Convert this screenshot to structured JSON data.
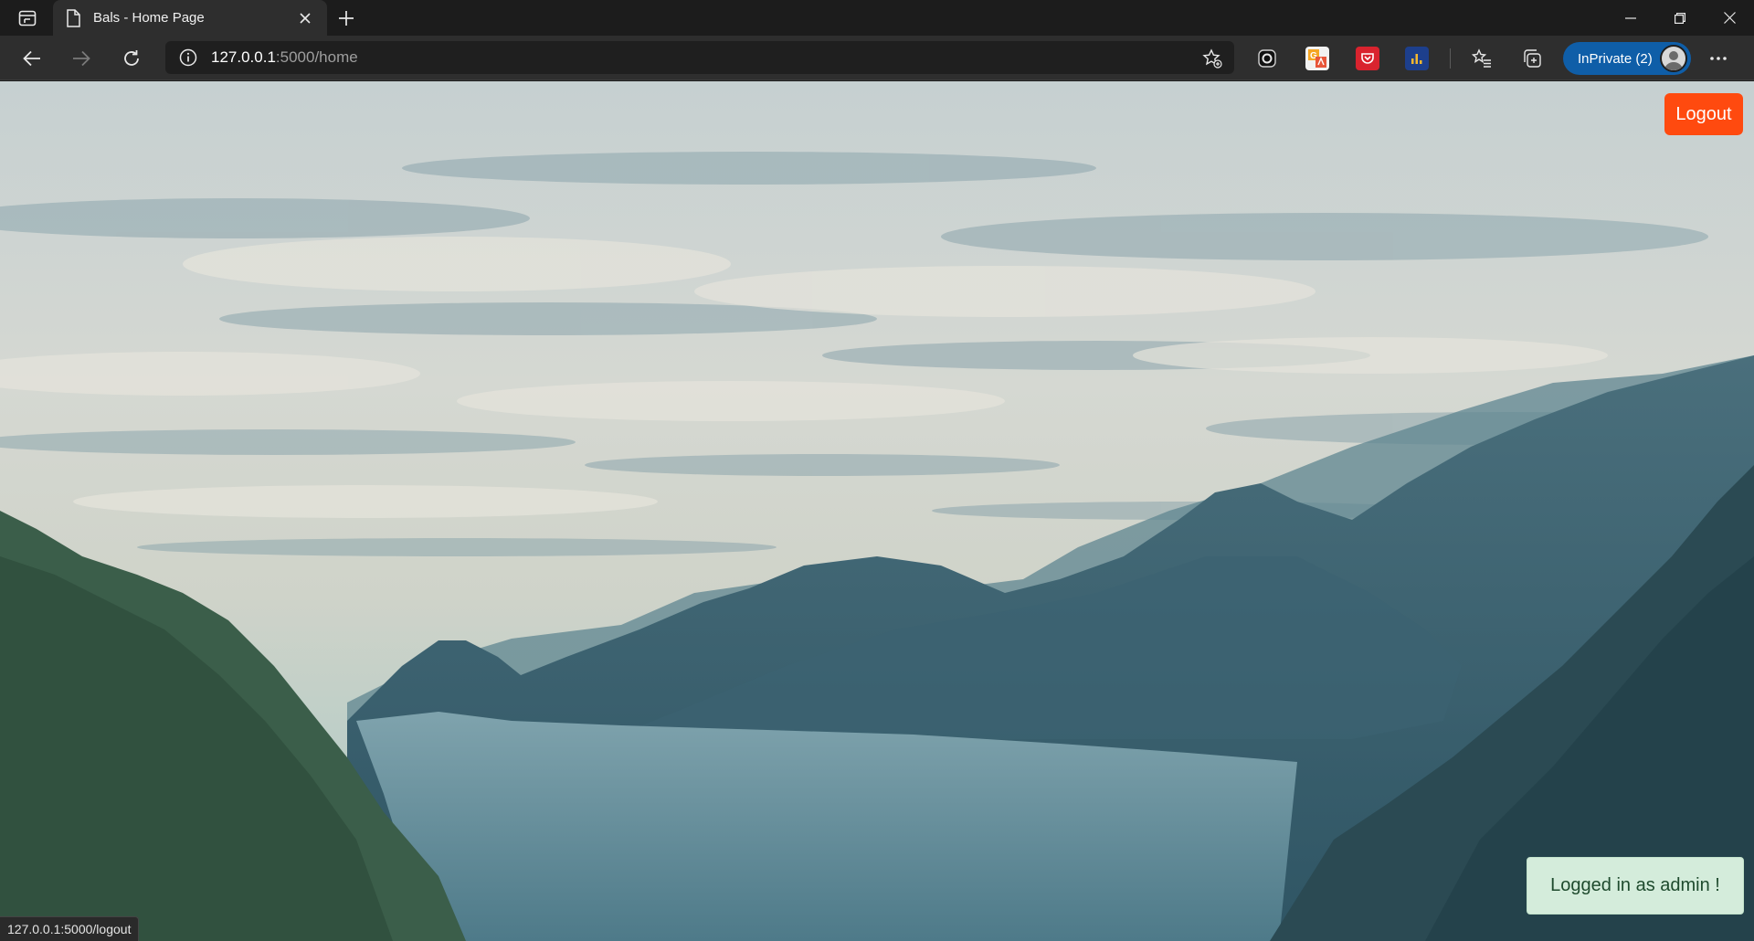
{
  "browser": {
    "tab": {
      "title": "Bals - Home Page"
    },
    "address": {
      "host": "127.0.0.1",
      "rest": ":5000/home"
    },
    "inprivate_label": "InPrivate (2)",
    "status_url": "127.0.0.1:5000/logout",
    "accent_color": "#0f5ea8"
  },
  "page": {
    "logout_label": "Logout",
    "logout_color": "#ff4a0f",
    "toast_message": "Logged in as admin !"
  }
}
